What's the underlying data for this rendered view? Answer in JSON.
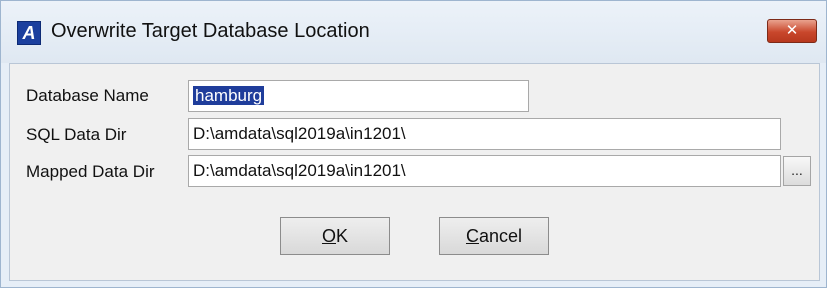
{
  "window": {
    "title": "Overwrite Target Database Location",
    "app_icon_letter": "A",
    "close_label": "✕"
  },
  "form": {
    "database_name": {
      "label": "Database Name",
      "value": "hamburg"
    },
    "sql_data_dir": {
      "label": "SQL Data Dir",
      "value": "D:\\amdata\\sql2019a\\in1201\\"
    },
    "mapped_data_dir": {
      "label": "Mapped Data Dir",
      "value": "D:\\amdata\\sql2019a\\in1201\\"
    },
    "browse_label": "..."
  },
  "buttons": {
    "ok": {
      "accel": "O",
      "rest": "K"
    },
    "cancel": {
      "accel": "C",
      "rest": "ancel"
    }
  },
  "colors": {
    "selection": "#1f3d9b",
    "close_button": "#c9472c",
    "app_icon": "#1b3f9e"
  }
}
